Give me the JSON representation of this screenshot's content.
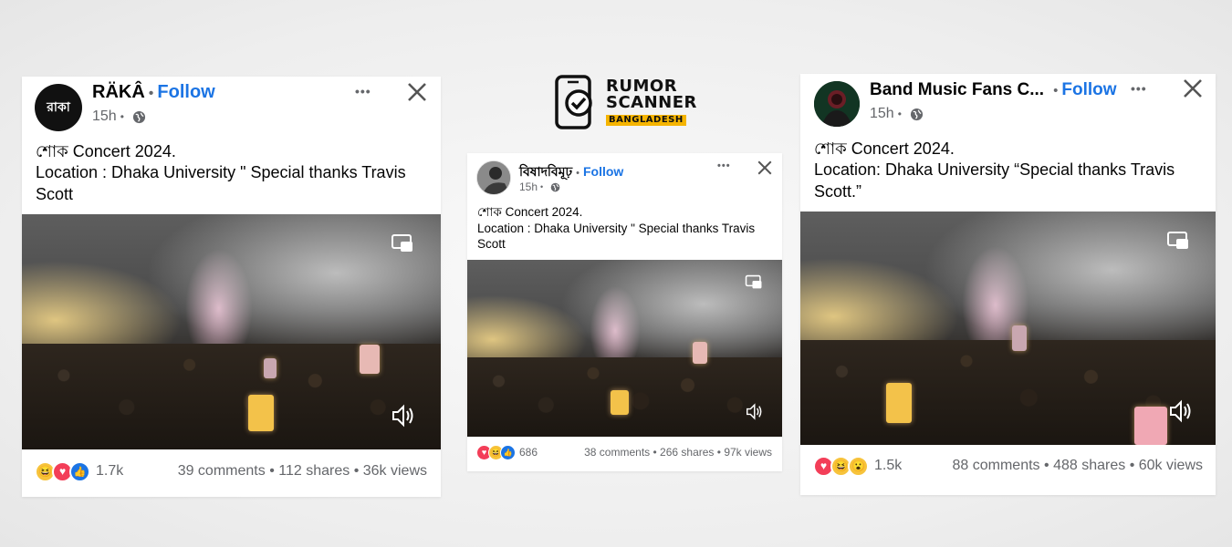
{
  "logo": {
    "line1": "RUMOR",
    "line2": "SCANNER",
    "badge": "BANGLADESH",
    "icon": "phone-check-icon"
  },
  "colors": {
    "follow_blue": "#1b74e4",
    "meta_gray": "#65676b",
    "badge_yellow": "#f5b400"
  },
  "posts": [
    {
      "author": "RÄKÂ",
      "avatar_text": "রাকা",
      "follow": "Follow",
      "separator": "•",
      "time": "15h",
      "more": "•••",
      "text_line1": "শোক Concert 2024.",
      "text_line2": "Location : Dhaka University \" Special thanks Travis Scott",
      "reaction_count": "1.7k",
      "comments": "39 comments",
      "shares": "112 shares",
      "views": "36k views",
      "reactions": [
        "haha",
        "love",
        "like"
      ]
    },
    {
      "author": "বিষাদবিমূঢ়",
      "follow": "Follow",
      "separator": "•",
      "time": "15h",
      "more": "•••",
      "text_line1": "শোক Concert 2024.",
      "text_line2": "Location : Dhaka University \" Special thanks Travis Scott",
      "reaction_count": "686",
      "comments": "38 comments",
      "shares": "266 shares",
      "views": "97k views",
      "reactions": [
        "love",
        "haha",
        "like"
      ]
    },
    {
      "author": "Band Music Fans C...",
      "follow": "Follow",
      "separator": "•",
      "time": "15h",
      "more": "•••",
      "text_line1": "শোক Concert 2024.",
      "text_line2": "Location: Dhaka University “Special thanks Travis Scott.”",
      "reaction_count": "1.5k",
      "comments": "88 comments",
      "shares": "488 shares",
      "views": "60k views",
      "reactions": [
        "love",
        "haha",
        "wow"
      ]
    }
  ],
  "stat_separator": "•"
}
